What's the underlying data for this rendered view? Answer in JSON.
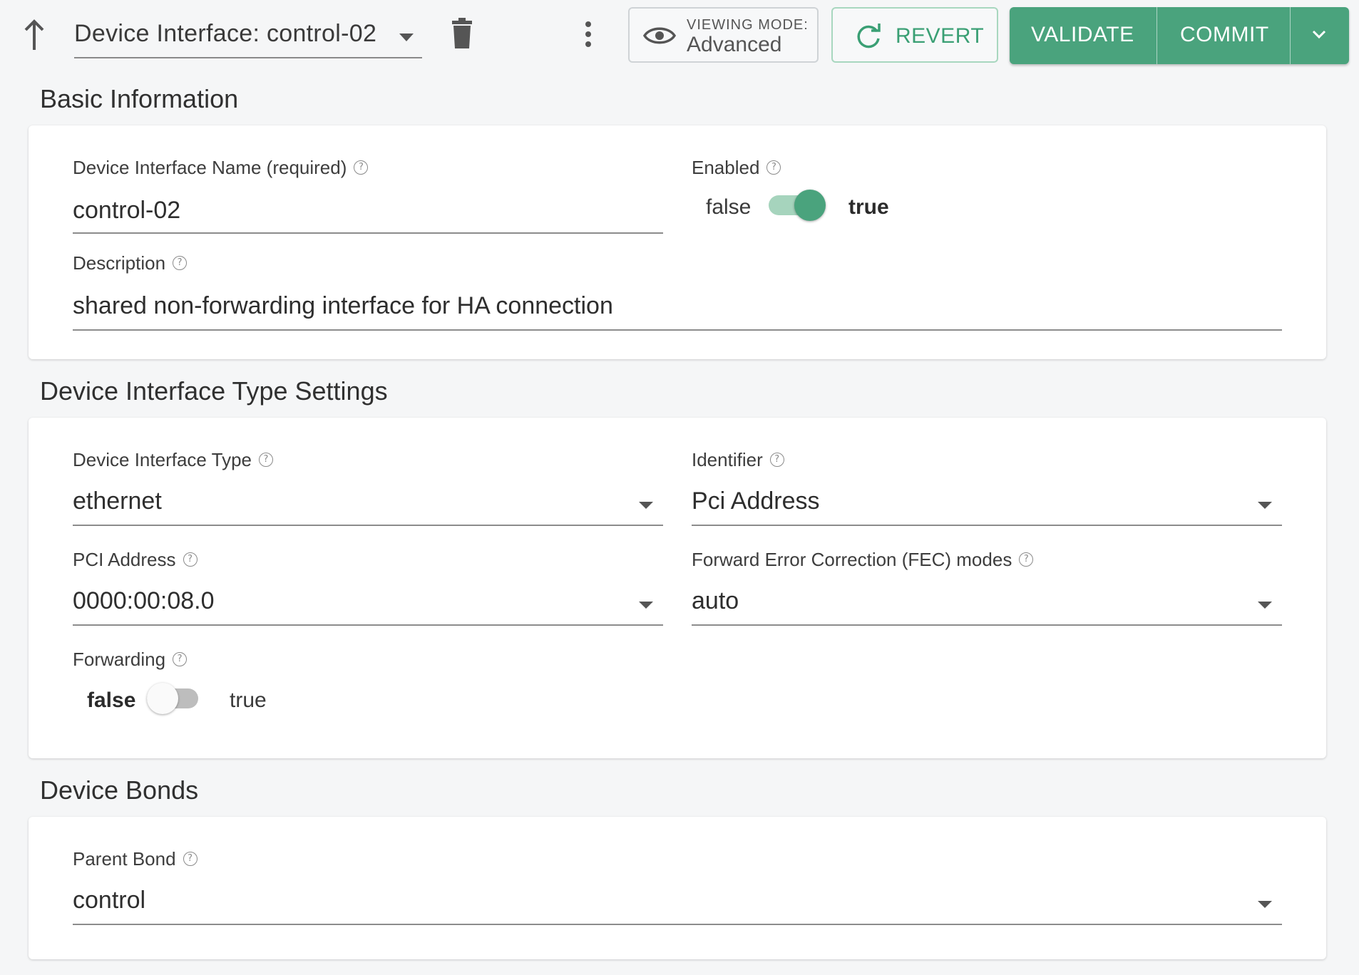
{
  "header": {
    "title": "Device Interface: control-02",
    "viewing_mode_label": "VIEWING MODE:",
    "viewing_mode_value": "Advanced",
    "revert_label": "REVERT",
    "validate_label": "VALIDATE",
    "commit_label": "COMMIT"
  },
  "basic": {
    "section_title": "Basic Information",
    "name_label": "Device Interface Name (required)",
    "name_value": "control-02",
    "enabled_label": "Enabled",
    "enabled_false": "false",
    "enabled_true": "true",
    "enabled_value": true,
    "description_label": "Description",
    "description_value": "shared non-forwarding interface for HA connection"
  },
  "type_settings": {
    "section_title": "Device Interface Type Settings",
    "type_label": "Device Interface Type",
    "type_value": "ethernet",
    "identifier_label": "Identifier",
    "identifier_value": "Pci Address",
    "pci_label": "PCI Address",
    "pci_value": "0000:00:08.0",
    "fec_label": "Forward Error Correction (FEC) modes",
    "fec_value": "auto",
    "forwarding_label": "Forwarding",
    "forwarding_false": "false",
    "forwarding_true": "true",
    "forwarding_value": false
  },
  "bonds": {
    "section_title": "Device Bonds",
    "parent_label": "Parent Bond",
    "parent_value": "control"
  },
  "help_glyph": "?",
  "colors": {
    "accent": "#4aa37d",
    "accent_light": "#a6d4bd",
    "switch_off_track": "#bdbdbd",
    "switch_off_knob": "#fafafa"
  }
}
